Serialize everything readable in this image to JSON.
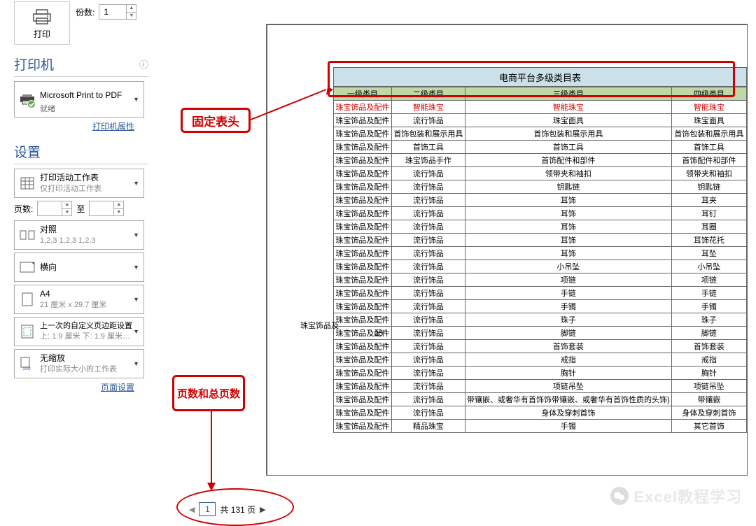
{
  "print": {
    "label": "打印"
  },
  "copies": {
    "label": "份数:",
    "value": "1"
  },
  "printer": {
    "title": "打印机",
    "name": "Microsoft Print to PDF",
    "status": "就绪",
    "props_link": "打印机属性"
  },
  "settings": {
    "title": "设置",
    "active_sheet": {
      "line1": "打印活动工作表",
      "line2": "仅打印活动工作表"
    },
    "pages_label": "页数:",
    "to_label": "至",
    "from": "",
    "to": "",
    "collate": {
      "line1": "对照",
      "line2": "1,2,3   1,2,3   1,2,3"
    },
    "orient": {
      "line1": "横向"
    },
    "paper": {
      "line1": "A4",
      "line2": "21 厘米 x 29.7 厘米"
    },
    "margins": {
      "line1": "上一次的自定义页边距设置",
      "line2": "上: 1.9 厘米 下: 1.9 厘米…"
    },
    "scaling": {
      "line1": "无缩放",
      "line2": "打印实际大小的工作表"
    },
    "page_setup_link": "页面设置"
  },
  "sheet": {
    "title": "电商平台多级类目表",
    "headers": [
      "一级类目",
      "二级类目",
      "三级类目",
      "四级类目"
    ],
    "row_red": [
      "珠宝饰品及配件",
      "智能珠宝",
      "智能珠宝",
      "智能珠宝"
    ],
    "rows": [
      [
        "珠宝饰品及配件",
        "流行饰品",
        "珠宝面具",
        "珠宝面具"
      ],
      [
        "珠宝饰品及配件",
        "首饰包装和展示用具",
        "首饰包装和展示用具",
        "首饰包装和展示用具"
      ],
      [
        "珠宝饰品及配件",
        "首饰工具",
        "首饰工具",
        "首饰工具"
      ],
      [
        "珠宝饰品及配件",
        "珠宝饰品手作",
        "首饰配件和部件",
        "首饰配件和部件"
      ],
      [
        "珠宝饰品及配件",
        "流行饰品",
        "领带夹和袖扣",
        "领带夹和袖扣"
      ],
      [
        "珠宝饰品及配件",
        "流行饰品",
        "钥匙链",
        "钥匙链"
      ],
      [
        "珠宝饰品及配件",
        "流行饰品",
        "耳饰",
        "耳夹"
      ],
      [
        "珠宝饰品及配件",
        "流行饰品",
        "耳饰",
        "耳钉"
      ],
      [
        "珠宝饰品及配件",
        "流行饰品",
        "耳饰",
        "耳圈"
      ],
      [
        "珠宝饰品及配件",
        "流行饰品",
        "耳饰",
        "耳饰花托"
      ],
      [
        "珠宝饰品及配件",
        "流行饰品",
        "耳饰",
        "耳坠"
      ],
      [
        "珠宝饰品及配件",
        "流行饰品",
        "小吊坠",
        "小吊坠"
      ],
      [
        "珠宝饰品及配件",
        "流行饰品",
        "项链",
        "项链"
      ],
      [
        "珠宝饰品及配件",
        "流行饰品",
        "手链",
        "手链"
      ],
      [
        "珠宝饰品及配件",
        "流行饰品",
        "手镯",
        "手镯"
      ],
      [
        "珠宝饰品及配件",
        "流行饰品",
        "珠子",
        "珠子"
      ],
      [
        "珠宝饰品及配件",
        "流行饰品",
        "脚链",
        "脚链"
      ],
      [
        "珠宝饰品及配件",
        "流行饰品",
        "首饰套装",
        "首饰套装"
      ],
      [
        "珠宝饰品及配件",
        "流行饰品",
        "戒指",
        "戒指"
      ],
      [
        "珠宝饰品及配件",
        "流行饰品",
        "胸针",
        "胸针"
      ],
      [
        "珠宝饰品及配件",
        "流行饰品",
        "项链吊坠",
        "项链吊坠"
      ],
      [
        "珠宝饰品及配件",
        "流行饰品",
        "带镶嵌、或奢华有首饰饰带镶嵌、或奢华有首饰性质的头饰)",
        "带镶嵌"
      ],
      [
        "珠宝饰品及配件",
        "流行饰品",
        "身体及穿刺首饰",
        "身体及穿刺首饰"
      ],
      [
        "珠宝饰品及配件",
        "精品珠宝",
        "手镯",
        "其它首饰"
      ]
    ],
    "footer_label": "珠宝饰品及",
    "footer_count": "25"
  },
  "callouts": {
    "fixed_header": "固定表头",
    "page_count": "页数和总页数"
  },
  "pager": {
    "current": "1",
    "total_text": "共 131 页"
  },
  "watermark": {
    "text": "Excel教程学习"
  }
}
